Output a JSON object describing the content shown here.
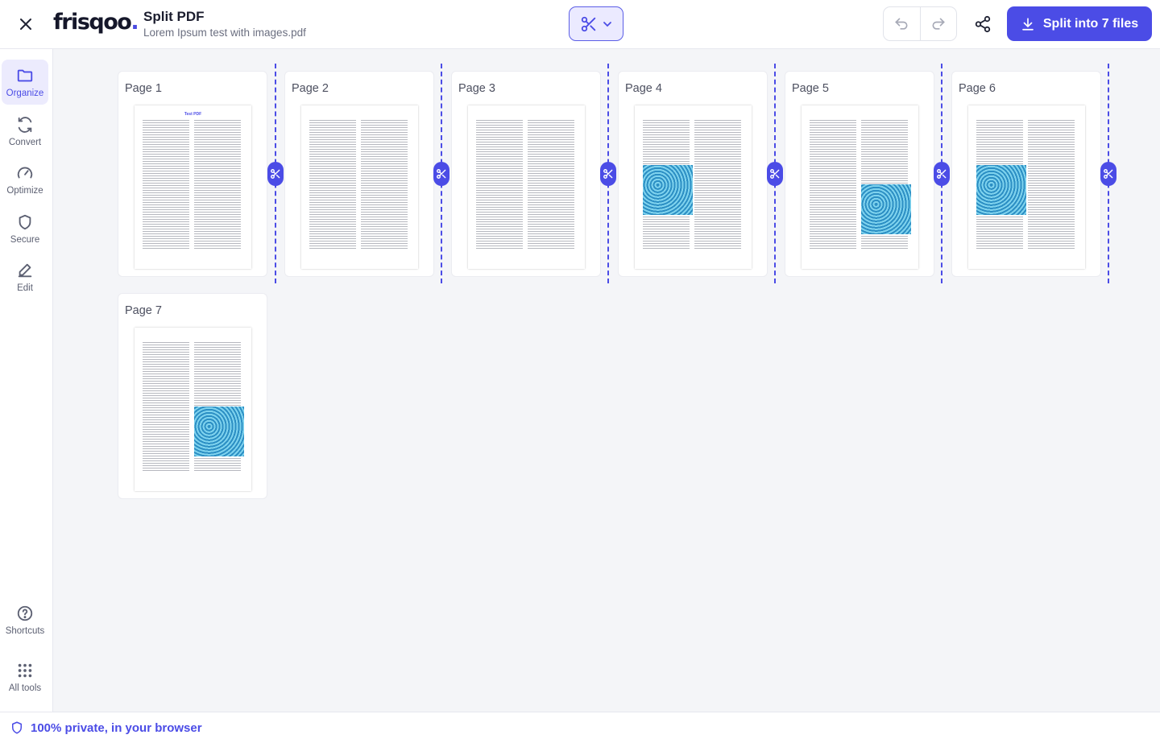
{
  "app": {
    "logo_text": "frisqoo",
    "logo_dot": ".",
    "title": "Split PDF",
    "filename": "Lorem Ipsum test with images.pdf"
  },
  "toolbar": {
    "split_button_label": "Split into 7 files"
  },
  "sidebar": {
    "items": [
      {
        "label": "Organize",
        "icon": "folder-icon",
        "active": true
      },
      {
        "label": "Convert",
        "icon": "refresh-icon"
      },
      {
        "label": "Optimize",
        "icon": "gauge-icon"
      },
      {
        "label": "Secure",
        "icon": "shield-icon"
      },
      {
        "label": "Edit",
        "icon": "pencil-icon"
      }
    ],
    "bottom_items": [
      {
        "label": "Shortcuts",
        "icon": "question-icon"
      },
      {
        "label": "All tools",
        "icon": "grid-dots-icon"
      }
    ]
  },
  "pages": [
    {
      "label": "Page 1",
      "doc_title": "Test PDF",
      "has_image": false
    },
    {
      "label": "Page 2",
      "has_image": false
    },
    {
      "label": "Page 3",
      "has_image": false
    },
    {
      "label": "Page 4",
      "has_image": true
    },
    {
      "label": "Page 5",
      "has_image": true
    },
    {
      "label": "Page 6",
      "has_image": true
    },
    {
      "label": "Page 7",
      "has_image": true
    }
  ],
  "footer": {
    "privacy_text": "100% private, in your browser"
  },
  "colors": {
    "accent": "#4b4ce6",
    "accent_light": "#ecebfd",
    "background": "#f4f5f8"
  }
}
